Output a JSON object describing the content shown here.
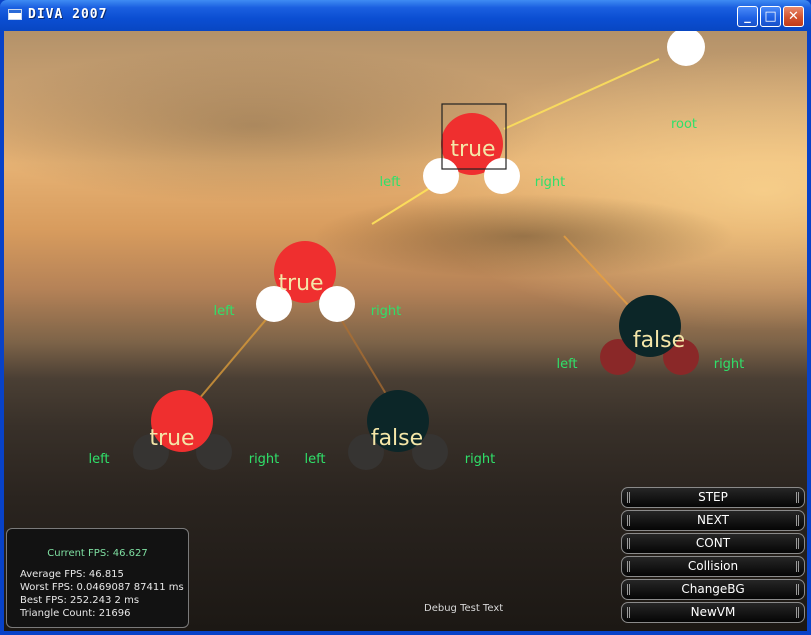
{
  "window": {
    "title": "DIVA 2007",
    "minimize": "_",
    "maximize": "□",
    "close": "✕",
    "icon": "app-window-icon"
  },
  "scene": {
    "root_label": "root",
    "nodes": [
      {
        "id": "n1",
        "text": "true",
        "color": "#ef2f2f",
        "left": "left",
        "right": "right",
        "selected": true
      },
      {
        "id": "n2",
        "text": "true",
        "color": "#ef2f2f",
        "left": "left",
        "right": "right"
      },
      {
        "id": "n3",
        "text": "false",
        "color": "#0c2628",
        "left": "left",
        "right": "right"
      },
      {
        "id": "n4",
        "text": "true",
        "color": "#ef2f2f",
        "left": "left",
        "right": "right"
      },
      {
        "id": "n5",
        "text": "false",
        "color": "#0c2628",
        "left": "left",
        "right": "right"
      }
    ]
  },
  "stats": {
    "current": "Current FPS: 46.627",
    "average": "Average FPS: 46.815",
    "worst": "Worst FPS: 0.0469087 87411 ms",
    "best": "Best FPS: 252.243 2 ms",
    "triangles": "Triangle Count: 21696"
  },
  "debug_text": "Debug Test Text",
  "buttons": [
    "STEP",
    "NEXT",
    "CONT",
    "Collision",
    "ChangeBG",
    "NewVM"
  ]
}
